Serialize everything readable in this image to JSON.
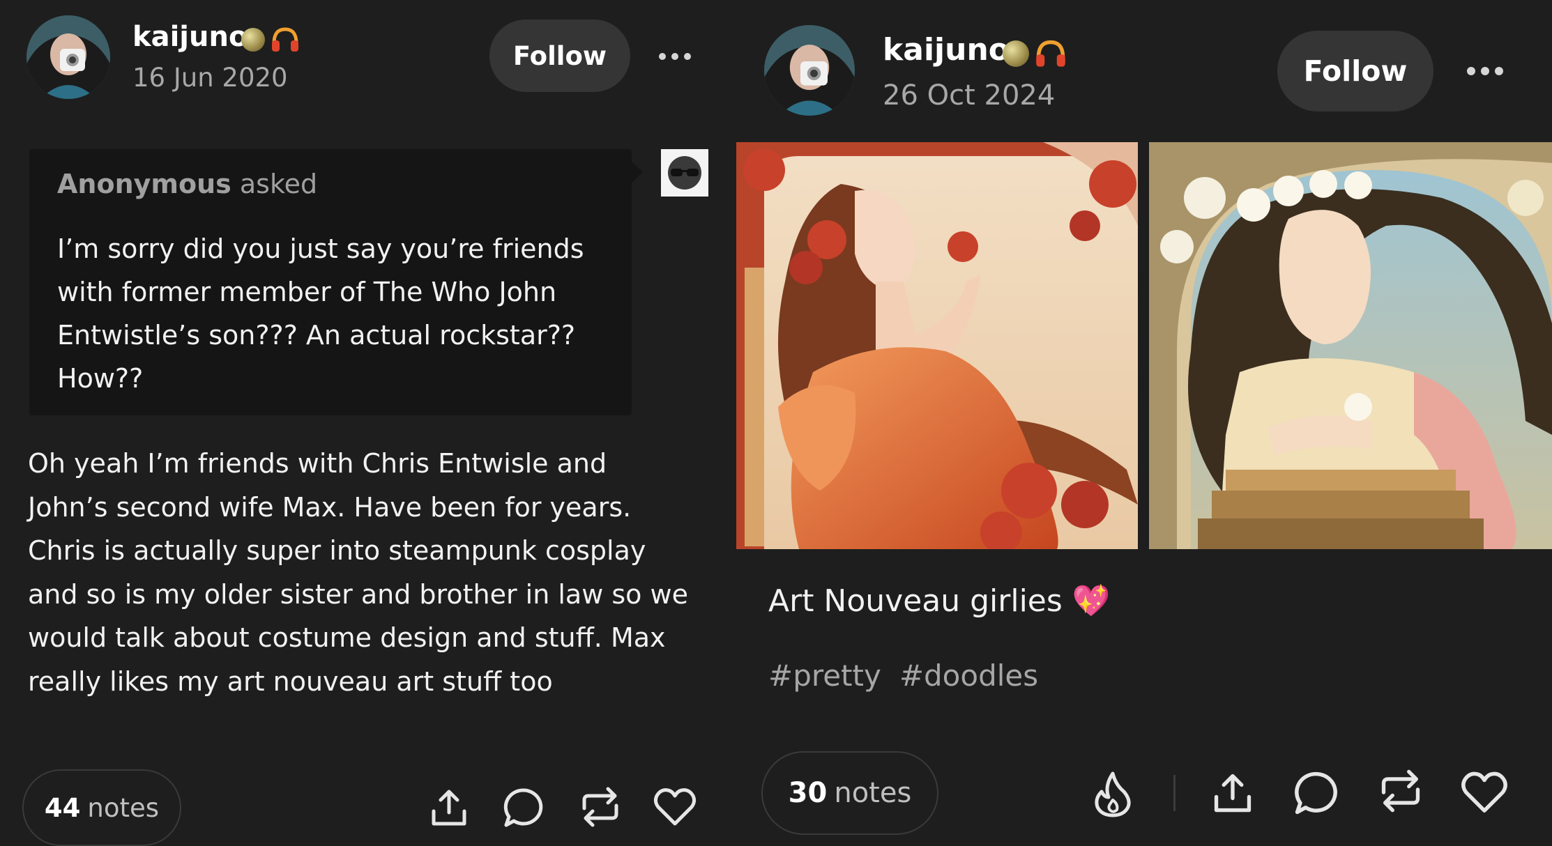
{
  "colors": {
    "background": "#1e1e1e",
    "follow_bg": "#353535",
    "ask_bg": "#151515",
    "muted_text": "#a8a8a8"
  },
  "post_left": {
    "username": "kaijuno",
    "date": "16 Jun 2020",
    "follow_label": "Follow",
    "ask": {
      "asker": "Anonymous",
      "asked_label": "asked",
      "question_lines": [
        "I’m sorry did you just say you’re friends",
        "with former member of The Who John",
        "Entwistle’s son??? An actual rockstar??",
        "How??"
      ]
    },
    "answer_lines": [
      "Oh yeah I’m friends with Chris Entwisle and",
      "John’s second wife Max. Have been for years.",
      "Chris is actually super into steampunk cosplay",
      "and so is my older sister and brother in law so we",
      "would talk about costume design and stuff. Max",
      "really likes my art nouveau art stuff too"
    ],
    "notes_count": "44",
    "notes_label": "notes",
    "icons": [
      "share-icon",
      "reply-icon",
      "reblog-icon",
      "like-icon"
    ]
  },
  "post_right": {
    "username": "kaijuno",
    "date": "26 Oct 2024",
    "follow_label": "Follow",
    "caption": "Art Nouveau girlies 💖",
    "tags": [
      "#pretty",
      "#doodles"
    ],
    "notes_count": "30",
    "notes_label": "notes",
    "icons": [
      "blaze-icon",
      "share-icon",
      "reply-icon",
      "reblog-icon",
      "like-icon"
    ]
  }
}
